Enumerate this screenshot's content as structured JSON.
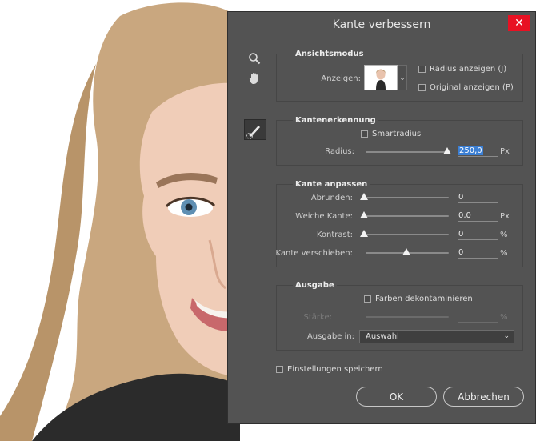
{
  "dialog": {
    "title": "Kante verbessern",
    "close_symbol": "✕"
  },
  "tools": {
    "zoom_icon": "magnifier",
    "hand_icon": "hand",
    "brush_icon": "refine-radius-brush"
  },
  "view_mode": {
    "title": "Ansichtsmodus",
    "show_label": "Anzeigen:",
    "radius_checkbox": "Radius anzeigen (J)",
    "original_checkbox": "Original anzeigen (P)",
    "radius_checked": false,
    "original_checked": false
  },
  "edge_detection": {
    "title": "Kantenerkennung",
    "smart_radius": "Smartradius",
    "smart_radius_checked": false,
    "radius_label": "Radius:",
    "radius_value": "250,0",
    "radius_unit": "Px",
    "radius_level": 0.95
  },
  "adjust_edge": {
    "title": "Kante anpassen",
    "smooth_label": "Abrunden:",
    "smooth_value": "0",
    "feather_label": "Weiche Kante:",
    "feather_value": "0,0",
    "feather_unit": "Px",
    "contrast_label": "Kontrast:",
    "contrast_value": "0",
    "contrast_unit": "%",
    "shift_label": "Kante verschieben:",
    "shift_value": "0",
    "shift_unit": "%"
  },
  "output": {
    "title": "Ausgabe",
    "decontaminate": "Farben dekontaminieren",
    "decontaminate_checked": false,
    "amount_label": "Stärke:",
    "amount_unit": "%",
    "output_to_label": "Ausgabe in:",
    "output_to_value": "Auswahl"
  },
  "remember": {
    "label": "Einstellungen speichern",
    "checked": false
  },
  "buttons": {
    "ok": "OK",
    "cancel": "Abbrechen"
  },
  "colors": {
    "dialog_bg": "#535353",
    "close_bg": "#e81123",
    "selection": "#3b7fd4"
  }
}
